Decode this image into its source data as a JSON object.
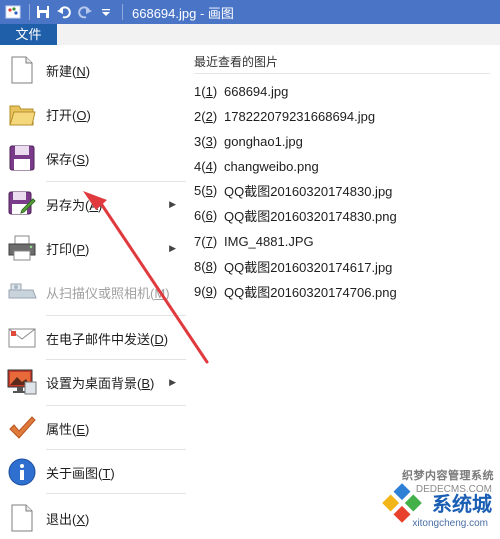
{
  "window": {
    "title": "668694.jpg - 画图"
  },
  "ribbon": {
    "file_tab": "文件"
  },
  "menu": {
    "items": [
      {
        "label": "新建",
        "key": "N",
        "icon": "new-file-icon"
      },
      {
        "label": "打开",
        "key": "O",
        "icon": "open-folder-icon"
      },
      {
        "label": "保存",
        "key": "S",
        "icon": "save-disk-icon"
      },
      {
        "label": "另存为",
        "key": "A",
        "icon": "save-as-icon",
        "submenu": true
      },
      {
        "label": "打印",
        "key": "P",
        "icon": "printer-icon",
        "submenu": true
      },
      {
        "label": "从扫描仪或照相机",
        "key": "M",
        "icon": "scanner-icon",
        "disabled": true
      },
      {
        "label": "在电子邮件中发送",
        "key": "D",
        "icon": "email-icon"
      },
      {
        "label": "设置为桌面背景",
        "key": "B",
        "icon": "desktop-background-icon",
        "submenu": true
      },
      {
        "label": "属性",
        "key": "E",
        "icon": "checkmark-icon"
      },
      {
        "label": "关于画图",
        "key": "T",
        "icon": "info-icon"
      },
      {
        "label": "退出",
        "key": "X",
        "icon": "exit-icon"
      }
    ]
  },
  "recent": {
    "title": "最近查看的图片",
    "files": [
      {
        "num": "1",
        "key": "1",
        "name": "668694.jpg"
      },
      {
        "num": "2",
        "key": "2",
        "name": "178222079231668694.jpg"
      },
      {
        "num": "3",
        "key": "3",
        "name": "gonghao1.jpg"
      },
      {
        "num": "4",
        "key": "4",
        "name": "changweibo.png"
      },
      {
        "num": "5",
        "key": "5",
        "name": "QQ截图20160320174830.jpg"
      },
      {
        "num": "6",
        "key": "6",
        "name": "QQ截图20160320174830.png"
      },
      {
        "num": "7",
        "key": "7",
        "name": "IMG_4881.JPG"
      },
      {
        "num": "8",
        "key": "8",
        "name": "QQ截图20160320174617.jpg"
      },
      {
        "num": "9",
        "key": "9",
        "name": "QQ截图20160320174706.png"
      }
    ]
  },
  "watermark": {
    "site": "织梦内容管理系统",
    "dede": "DEDECMS.COM",
    "brand": "系统城",
    "domain": "xitongcheng.com"
  },
  "colors": {
    "titlebar": "#4a75c7",
    "file_tab": "#1f5ea8",
    "arrow": "#e0393e"
  }
}
